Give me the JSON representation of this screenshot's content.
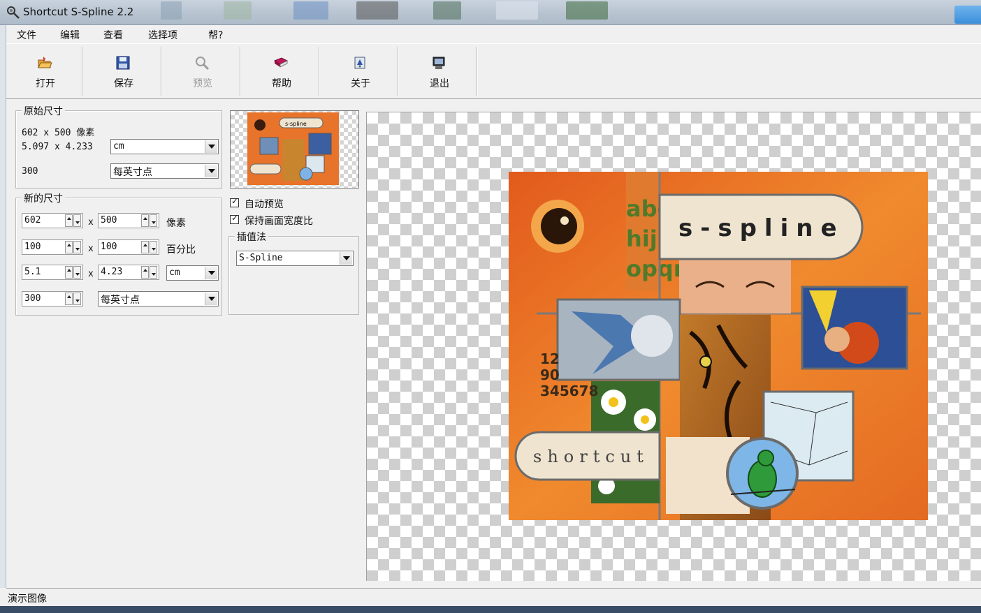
{
  "window": {
    "title": "Shortcut S-Spline 2.2"
  },
  "menu": [
    "文件",
    "编辑",
    "查看",
    "选择项",
    "帮?"
  ],
  "toolbar": [
    {
      "label": "打开",
      "icon": "open-folder-icon",
      "enabled": true
    },
    {
      "label": "保存",
      "icon": "floppy-disk-icon",
      "enabled": true
    },
    {
      "label": "预览",
      "icon": "magnifier-icon",
      "enabled": false
    },
    {
      "label": "帮助",
      "icon": "help-book-icon",
      "enabled": true
    },
    {
      "label": "关于",
      "icon": "about-icon",
      "enabled": true
    },
    {
      "label": "退出",
      "icon": "exit-icon",
      "enabled": true
    }
  ],
  "original_size": {
    "title": "原始尺寸",
    "pixels": "602  x  500  像素",
    "physical": "5.097  x  4.233",
    "unit": "cm",
    "resolution": "300",
    "resolution_unit": "每英寸点"
  },
  "new_size": {
    "title": "新的尺寸",
    "x_sep": "x",
    "width_px": "602",
    "height_px": "500",
    "px_label": "像素",
    "width_pct": "100",
    "height_pct": "100",
    "pct_label": "百分比",
    "width_unit": "5.1",
    "height_unit": "4.23",
    "unit": "cm",
    "resolution": "300",
    "resolution_unit": "每英寸点"
  },
  "options": {
    "auto_preview": {
      "label": "自动预览",
      "checked": true
    },
    "keep_aspect": {
      "label": "保持画面宽度比",
      "checked": true
    }
  },
  "interpolation": {
    "title": "插值法",
    "method": "S-Spline"
  },
  "artwork": {
    "brand_badge": "s-spline",
    "logo_text": "shortcut",
    "letters": [
      "abc",
      "hij",
      "opqr"
    ],
    "digits": [
      "12",
      "90",
      "345678"
    ]
  },
  "status": {
    "text": "演示图像"
  },
  "colors": {
    "accent_orange": "#e8732a",
    "checker": "#cfcfcf",
    "window_bg": "#f0f0f0"
  }
}
